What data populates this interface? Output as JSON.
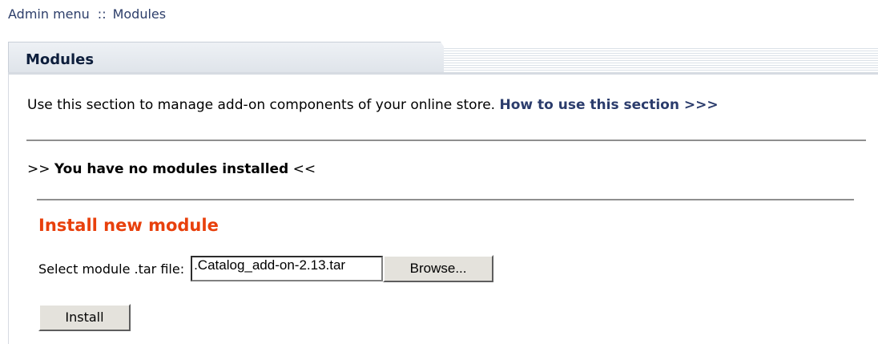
{
  "breadcrumb": {
    "root": "Admin menu",
    "separator": "::",
    "current": "Modules"
  },
  "panel": {
    "title": "Modules"
  },
  "intro": {
    "text": "Use this section to manage add-on components of your online store. ",
    "link": "How to use this section >>>"
  },
  "status": {
    "prefix": ">>",
    "message": "You have no modules installed",
    "suffix": "<<"
  },
  "install_section": {
    "title": "Install new module",
    "file_label": "Select module .tar file:",
    "file_value": ".Catalog_add-on-2.13.tar",
    "browse_label": "Browse...",
    "install_label": "Install"
  },
  "colors": {
    "link": "#2b3c6c",
    "section_title": "#e8400c"
  }
}
